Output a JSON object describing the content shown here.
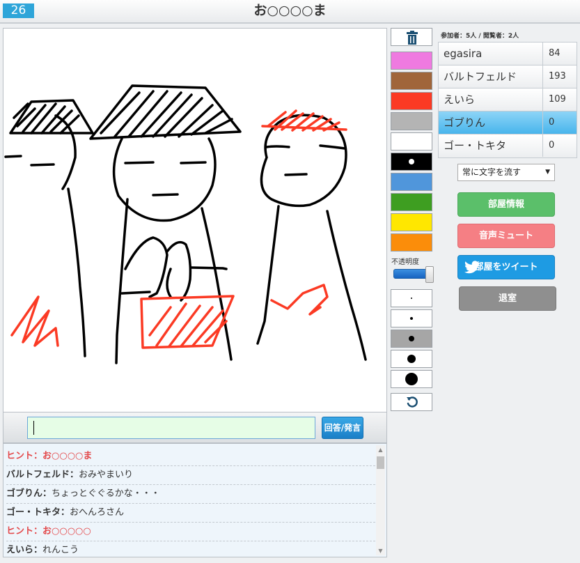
{
  "header": {
    "timer": "26",
    "title": "お○○○○ま"
  },
  "canvas": {
    "description_icon": "drawing-canvas"
  },
  "answer": {
    "input_value": "",
    "button_label": "回答/発言"
  },
  "chat": {
    "lines": [
      {
        "who": "ヒント：",
        "msg": "お○○○○ま",
        "hint": true
      },
      {
        "who": "バルトフェルド：",
        "msg": "おみやまいり",
        "hint": false
      },
      {
        "who": "ゴブりん：",
        "msg": "ちょっとぐぐるかな・・・",
        "hint": false
      },
      {
        "who": "ゴー・トキタ：",
        "msg": "おへんろさん",
        "hint": false
      },
      {
        "who": "ヒント：",
        "msg": "お○○○○○",
        "hint": true
      },
      {
        "who": "えいら：",
        "msg": "れんこう",
        "hint": false
      }
    ]
  },
  "tools": {
    "trash_icon": "trash-icon",
    "colors": [
      "#ef7ae0",
      "#a0653a",
      "#fb3a24",
      "#b4b4b4",
      "#ffffff",
      "#000000",
      "#5096db",
      "#3e9e21",
      "#ffe700",
      "#fb8d0a"
    ],
    "opacity_label": "不透明度",
    "opacity_value": 1.0,
    "brush_sizes": [
      2,
      4,
      8,
      12,
      18
    ],
    "selected_brush_index": 2,
    "undo_icon": "undo-icon"
  },
  "room": {
    "counts": "参加者：5人 / 閲覧者：2人",
    "players": [
      {
        "name": "egasira",
        "score": "84",
        "active": false
      },
      {
        "name": "バルトフェルド",
        "score": "193",
        "active": false
      },
      {
        "name": "えいら",
        "score": "109",
        "active": false
      },
      {
        "name": "ゴブりん",
        "score": "0",
        "active": true
      },
      {
        "name": "ゴー・トキタ",
        "score": "0",
        "active": false
      }
    ],
    "flow_option": "常に文字を流す",
    "buttons": {
      "room_info": "部屋情報",
      "mute": "音声ミュート",
      "tweet": "部屋をツイート",
      "leave": "退室"
    }
  }
}
